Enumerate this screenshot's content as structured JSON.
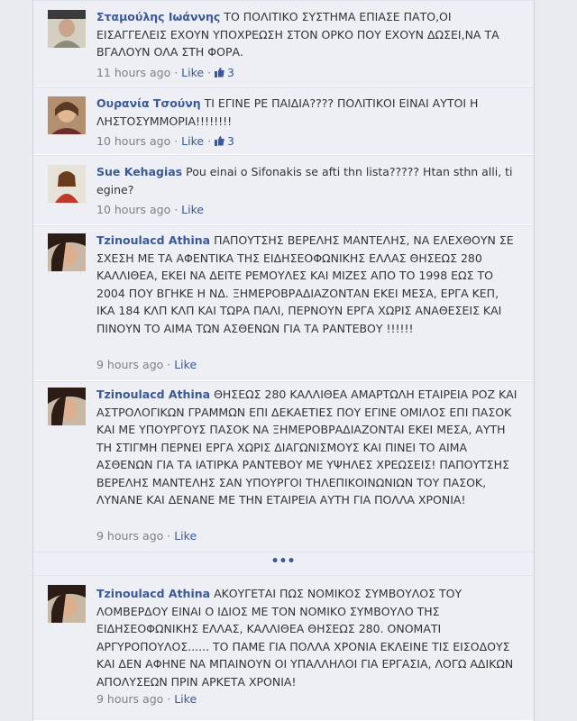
{
  "comments": [
    {
      "author": "Σταμούλης Ιωάννης",
      "text": "ΤΟ ΠΟΛΙΤΙΚΟ ΣΥΣΤΗΜΑ ΕΠΙΑΣΕ ΠΑΤΟ,ΟΙ ΕΙΣΑΓΓΕΛΕΙΣ ΕΧΟΥΝ ΥΠΟΧΡΕΩΣΗ ΣΤΟΝ ΟΡΚΟ ΠΟΥ ΕΧΟΥΝ ΔΩΣΕΙ,ΝΑ ΤΑ ΒΓΑΛΟΥΝ ΟΛΑ ΣΤΗ ΦΟΡΑ.",
      "time": "11 hours ago",
      "like": "Like",
      "likes": "3"
    },
    {
      "author": "Ουρανία Τσούνη",
      "text": "ΤΙ ΕΓΙΝΕ ΡΕ ΠΑΙΔΙΑ???? ΠΟΛΙΤΙΚΟΙ ΕΙΝΑΙ ΑΥΤΟΙ Η ΛΗΣΤΟΣΥΜΜΟΡΙΑ!!!!!!!!",
      "time": "10 hours ago",
      "like": "Like",
      "likes": "3"
    },
    {
      "author": "Sue Kehagias",
      "text": "Pou einai o Sifonakis se afti thn lista????? Htan sthn alli, ti egine?",
      "time": "10 hours ago",
      "like": "Like"
    },
    {
      "author": "Tzinoulacd Athina",
      "text": "ΠΑΠΟΥΤΣΗΣ ΒΕΡΕΛΗΣ ΜΑΝΤΕΛΗΣ, ΝΑ ΕΛΕΧΘΟΥΝ ΣΕ ΣΧΕΣΗ ΜΕ ΤΑ ΑΦΕΝΤΙΚΑ ΤΗΣ ΕΙΔΗΣΕΟΦΩΝΙΚΗΣ ΕΛΛΑΣ ΘΗΣΕΩΣ 280 ΚΑΛΛΙΘΕΑ, ΕΚΕΙ ΝΑ ΔΕΙΤΕ ΡΕΜΟΥΛΕΣ ΚΑΙ ΜΙΖΕΣ ΑΠΟ ΤΟ 1998 ΕΩΣ ΤΟ 2004 ΠΟΥ ΒΓΗΚΕ Η ΝΔ. ΞΗΜΕΡΟΒΡΑΔΙΑΖΟΝΤΑΝ ΕΚΕΙ ΜΕΣΑ, ΕΡΓΑ ΚΕΠ, ΙΚΑ 184 ΚΛΠ ΚΛΠ ΚΑΙ ΤΩΡΑ ΠΑΛΙ, ΠΕΡΝΟΥΝ ΕΡΓΑ ΧΩΡΙΣ ΑΝΑΘΕΣΕΙΣ ΚΑΙ ΠΙΝΟΥΝ ΤΟ ΑΙΜΑ ΤΩΝ ΑΣΘΕΝΩΝ ΓΙΑ ΤΑ ΡΑΝΤΕΒΟΥ !!!!!!",
      "time": "9 hours ago",
      "like": "Like"
    },
    {
      "author": "Tzinoulacd Athina",
      "text": "ΘΗΣΕΩΣ 280 ΚΑΛΛΙΘΕΑ ΑΜΑΡΤΩΛΗ ΕΤΑΙΡΕΙΑ ΡΟΖ ΚΑΙ ΑΣΤΡΟΛΟΓΙΚΩΝ ΓΡΑΜΜΩΝ ΕΠΙ ΔΕΚΑΕΤΙΕΣ ΠΟΥ ΕΓΙΝΕ ΟΜΙΛΟΣ ΕΠΙ ΠΑΣΟΚ ΚΑΙ ΜΕ ΥΠΟΥΡΓΟΥΣ ΠΑΣΟΚ ΝΑ ΞΗΜΕΡΟΒΡΑΔΙΑΖΟΝΤΑΙ ΕΚΕΙ ΜΕΣΑ, ΑΥΤΗ ΤΗ ΣΤΙΓΜΗ ΠΕΡΝΕΙ ΕΡΓΑ ΧΩΡΙΣ ΔΙΑΓΩΝΙΣΜΟΥΣ ΚΑΙ ΠΙΝΕΙ ΤΟ ΑΙΜΑ ΑΣΘΕΝΩΝ ΓΙΑ ΤΑ ΙΑΤΙΡΚΑ ΡΑΝΤΕΒΟΥ ΜΕ ΥΨΗΛΕΣ ΧΡΕΩΣΕΙΣ! ΠΑΠΟΥΤΣΗΣ ΒΕΡΕΛΗΣ ΜΑΝΤΕΛΗΣ ΣΑΝ ΥΠΟΥΡΓΟΙ ΤΗΛΕΠΙΚΟΙΝΩΝΙΩΝ ΤΟΥ ΠΑΣΟΚ, ΛΥΝΑΝΕ ΚΑΙ ΔΕΝΑΝΕ ΜΕ ΤΗΝ ΕΤΑΙΡΕΙΑ ΑΥΤΗ ΓΙΑ ΠΟΛΛΑ ΧΡΟΝΙΑ!",
      "time": "9 hours ago",
      "like": "Like"
    },
    {
      "author": "Tzinoulacd Athina",
      "text": "ΑΚΟΥΓΕΤΑΙ ΠΩΣ ΝΟΜΙΚΟΣ ΣΥΜΒΟΥΛΟΣ ΤΟΥ ΛΟΜΒΕΡΔΟΥ ΕΙΝΑΙ Ο ΙΔΙΟΣ ΜΕ ΤΟΝ ΝΟΜΙΚΟ ΣΥΜΒΟΥΛΟ ΤΗΣ ΕΙΔΗΣΕΟΦΩΝΙΚΗΣ ΕΛΛΑΣ, ΚΑΛΛΙΘΕΑ ΘΗΣΕΩΣ 280. ΟΝΟΜΑΤΙ ΑΡΓΥΡΟΠΟΥΛΟΣ...... ΤΟ ΠΑΜΕ ΓΙΑ ΠΟΛΛΑ ΧΡΟΝΙΑ ΕΚΛΕΙΝΕ ΤΙΣ ΕΙΣΟΔΟΥΣ ΚΑΙ ΔΕΝ ΑΦΗΝΕ ΝΑ ΜΠΑΙΝΟΥΝ ΟΙ ΥΠΑΛΛΗΛΟΙ ΓΙΑ ΕΡΓΑΣΙΑ, ΛΟΓΩ ΑΔΙΚΩΝ ΑΠΟΛΥΣΕΩΝ ΠΡΙΝ ΑΡΚΕΤΑ ΧΡΟΝΙΑ!",
      "time": "9 hours ago",
      "like": "Like"
    }
  ],
  "more_label": "•••",
  "separator": " · ",
  "colors": {
    "link": "#3b5998",
    "meta": "#808080",
    "row_bg": "#edeff4",
    "page_bg": "#e9ebee"
  }
}
